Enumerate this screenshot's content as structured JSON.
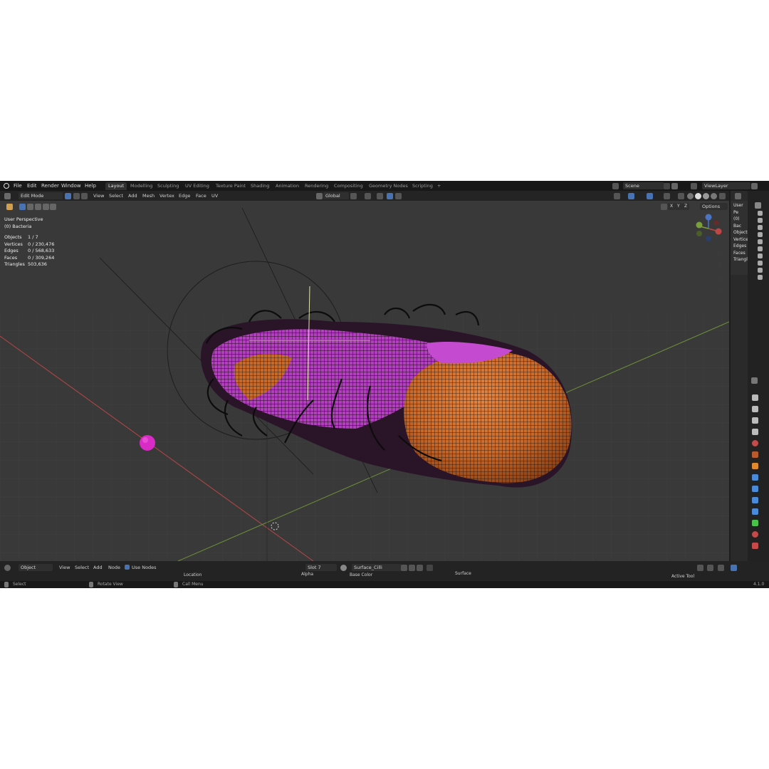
{
  "app": {
    "version": "4.1.0"
  },
  "menu": [
    "File",
    "Edit",
    "Render",
    "Window",
    "Help"
  ],
  "workspaces": [
    "Layout",
    "Modelling",
    "Sculpting",
    "UV Editing",
    "Texture Paint",
    "Shading",
    "Animation",
    "Rendering",
    "Compositing",
    "Geometry Nodes",
    "Scripting",
    "+"
  ],
  "active_workspace": "Layout",
  "scene": {
    "name": "Scene",
    "view_layer": "ViewLayer"
  },
  "header": {
    "mode": "Edit Mode",
    "menus": [
      "View",
      "Select",
      "Add",
      "Mesh",
      "Vertex",
      "Edge",
      "Face",
      "UV"
    ],
    "transform": "Global",
    "options": "Options",
    "axes": [
      "X",
      "Y",
      "Z"
    ]
  },
  "viewport": {
    "perspective": "User Perspective",
    "object": "(0) Bacteria",
    "stats": [
      {
        "label": "Objects",
        "value": "1 / 7"
      },
      {
        "label": "Vertices",
        "value": "0 / 230,476"
      },
      {
        "label": "Edges",
        "value": "0 / 568,633"
      },
      {
        "label": "Faces",
        "value": "0 / 309,264"
      },
      {
        "label": "Triangles",
        "value": "503,636"
      }
    ],
    "colors": {
      "background": "#393939",
      "mesh_orange": "#c8692c",
      "mesh_pink": "#b43ec4",
      "x_axis": "#b84646",
      "y_axis": "#7a9a3a"
    }
  },
  "outliner": {
    "perspective_short": "User Pe",
    "object_short": "(0) Bac",
    "labels": [
      "Objects",
      "Vertice",
      "Edges",
      "Faces",
      "Triangle"
    ]
  },
  "node_editor": {
    "mode": "Object",
    "menus": [
      "View",
      "Select",
      "Add",
      "Node"
    ],
    "use_nodes_label": "Use Nodes",
    "slot": "Slot 7",
    "material": "Surface_Cilli",
    "nodes": [
      "Location",
      "Alpha",
      "Base Color",
      "Surface"
    ],
    "active_tool": "Active Tool"
  },
  "status_bar": {
    "select": "Select",
    "rotate": "Rotate View",
    "menu": "Call Menu"
  }
}
